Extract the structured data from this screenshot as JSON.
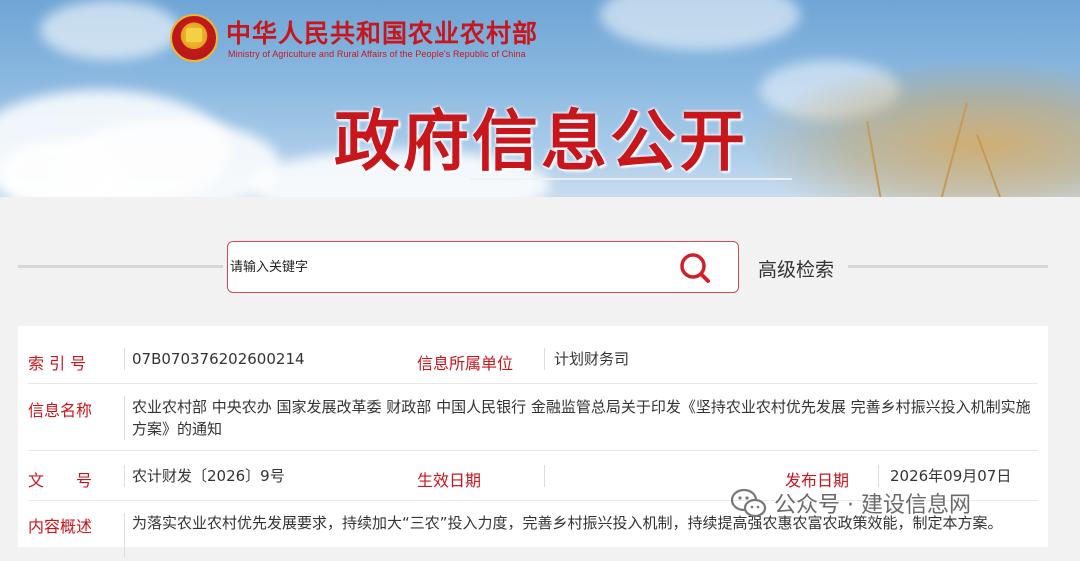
{
  "header": {
    "ministry_cn": "中华人民共和国农业农村部",
    "ministry_en": "Ministry of Agriculture and Rural Affairs of the People's Republic of China",
    "page_title": "政府信息公开",
    "brand_color": "#c8161d"
  },
  "search": {
    "placeholder": "请输入关键字",
    "advanced_label": "高级检索",
    "icon": "search-icon"
  },
  "info": {
    "index_label": "索 引 号",
    "index_value": "07B070376202600214",
    "unit_label": "信息所属单位",
    "unit_value": "计划财务司",
    "name_label": "信息名称",
    "name_value": "农业农村部 中央农办 国家发展改革委 财政部 中国人民银行 金融监管总局关于印发《坚持农业农村优先发展 完善乡村振兴投入机制实施方案》的通知",
    "doc_label": "文　　号",
    "doc_value": "农计财发〔2026〕9号",
    "effective_label": "生效日期",
    "effective_value": "",
    "publish_label": "发布日期",
    "publish_value": "2026年09月07日",
    "summary_label": "内容概述",
    "summary_value": "为落实农业农村优先发展要求，持续加大“三农”投入力度，完善乡村振兴投入机制，持续提高强农惠农富农政策效能，制定本方案。"
  },
  "watermark": {
    "text": "公众号 · 建设信息网",
    "icon": "wechat-icon"
  }
}
